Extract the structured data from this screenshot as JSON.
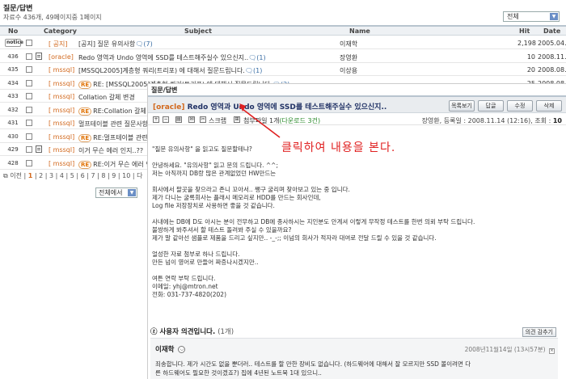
{
  "board": {
    "title": "질문/답변",
    "count_text": "자료수 436개, 49페이지중 1페이지",
    "scope": "전체"
  },
  "list": {
    "headers": {
      "no": "No",
      "category": "Category",
      "subject": "Subject",
      "name": "Name",
      "hit": "Hit",
      "date": "Date"
    },
    "rows": [
      {
        "no": "notice",
        "cat": "[ 공지]",
        "re": "",
        "subject": "[공지] 질문 유의사항",
        "comments": "(7)",
        "name": "이재학",
        "hit": "2,198",
        "date": "2005.04.09"
      },
      {
        "no": "436",
        "cat": "[oracle]",
        "re": "",
        "subject": "Redo 영역과 Undo 영역에 SSD를 테스트해주실수 있으신지..",
        "comments": "(1)",
        "name": "장영환",
        "hit": "10",
        "date": "2008.11.14"
      },
      {
        "no": "435",
        "cat": "[ mssql]",
        "re": "",
        "subject": "[MSSQL2005]계층형 쿼리(트리포) 에 대해서 질문드립니다.",
        "comments": "(1)",
        "name": "이상용",
        "hit": "20",
        "date": "2008.08.06"
      },
      {
        "no": "434",
        "cat": "[ mssql]",
        "re": "RE",
        "subject": "RE: [MSSQL2005]계층형 쿼리(트리포) 에 대해서 질문드립니다.",
        "comments": "(2)",
        "name": "",
        "hit": "25",
        "date": "2008.08.07"
      },
      {
        "no": "433",
        "cat": "[ mssql]",
        "re": "",
        "subject": "Collation 갈체 변경",
        "comments": "",
        "name": "",
        "hit": "",
        "date": ""
      },
      {
        "no": "432",
        "cat": "[ mssql]",
        "re": "RE",
        "subject": "RE:Collation 갈체 변",
        "comments": "",
        "name": "",
        "hit": "",
        "date": ""
      },
      {
        "no": "431",
        "cat": "[ mssql]",
        "re": "",
        "subject": "멀프테이블 관련 질문사항",
        "comments": "",
        "name": "",
        "hit": "",
        "date": ""
      },
      {
        "no": "430",
        "cat": "[ mssql]",
        "re": "RE",
        "subject": "RE:멀프테이블 관련",
        "comments": "",
        "name": "",
        "hit": "",
        "date": ""
      },
      {
        "no": "429",
        "cat": "[ mssql]",
        "re": "",
        "subject": "이거 무슨 에러 인지..??",
        "comments": "",
        "name": "",
        "hit": "",
        "date": ""
      },
      {
        "no": "428",
        "cat": "[ mssql]",
        "re": "RE",
        "subject": "RE:이거 무슨 에러 인",
        "comments": "",
        "name": "",
        "hit": "",
        "date": ""
      }
    ]
  },
  "pager": {
    "prev": "이전",
    "pages": [
      "1",
      "2",
      "3",
      "4",
      "5",
      "6",
      "7",
      "8",
      "9",
      "10"
    ],
    "current": "1",
    "suffix": "다"
  },
  "search": {
    "scope": "전체에서"
  },
  "article": {
    "board_title": "질문/답변",
    "category": "[oracle]",
    "title": "Redo 영역과 Undo 영역에 SSD를 테스트해주실수 있으신지..",
    "buttons": {
      "list": "목록보기",
      "reply": "답글",
      "edit": "수정",
      "delete": "삭제"
    },
    "toolbar": {
      "scrap": "스크랩",
      "attach_prefix": "첨부파일 1개",
      "attach_download": "(다운로드 3건)"
    },
    "meta": {
      "author": "장영환",
      "registered_label": ", 등록일 :",
      "date": "2008.11.14 (12:16)",
      "views_label": ", 조회 :",
      "views": "10"
    },
    "annotation": "클릭하여 내용을 본다.",
    "body": [
      [
        "\"질문 유의사항\" 을 읽고도 질문할테냐?"
      ],
      [
        "안녕하세요. \"유의사항\" 읽고 문의 드립니다. ^^;",
        "저는 아직까지 DB랑 많은 관계없었던 HW만드는"
      ],
      [
        "회사에서 팔곳을 찾으라고 존니 꼬아서.. 쨍구 굴리며 찾아보고 있는 중 입니다.",
        "제가 다니는 굴록회사는 플래시 메모리로 HDD를 만드는 회사인데,",
        "Log file 저장장치로 사용하면 좋을 것 같습니다."
      ],
      [
        "사내에는 DB에 D도 아시는 분이 전무하고 DB에 종사하시는 지인분도 안계셔 이렇게 무작정 테스트를 한번 의뢰 부탁 드립니다.",
        "불쌍하게 봐주셔서 할 테스트 돌려봐 주실 수 있을까요?",
        "제가 말 같아선 샘플로 제품을 드리고 싶지만.. -_-;; 이넘의 회사가 적자라 대여로 전달 드릴 수 있을 것 같습니다."
      ],
      [
        "얼성한 자료 첨부로 하나 드립니다.",
        "만든 넘이 영어로 만들어 짜증나시겠지만.."
      ],
      [
        "여튼 연락 부탁 드립니다.",
        "이메일: yhj@mtron.net",
        "전화: 031-737-4820(202)"
      ]
    ],
    "comments": {
      "header": "사용자 의견입니다.",
      "count": "(1개)",
      "fold": "의견 감추기",
      "items": [
        {
          "author": "이재학",
          "date": "2008년11월14일 (13시57분)",
          "lines": [
            "죄송합니다. 제가 시간도 없을 뿐더러.. 테스트를 할 만한 장비도 없습니다. (하드웨어에 대해서 잘 모르지만 SSD 볼이려면 다",
            "른 하드웨어도 필요한 것이겠죠?) 집에 4년된 노트북 1대 있으니.."
          ]
        }
      ]
    }
  },
  "colors": {
    "category": "#d2691e",
    "annotation": "#e02020",
    "accent": "#6b8fc6",
    "title": "#223366"
  }
}
